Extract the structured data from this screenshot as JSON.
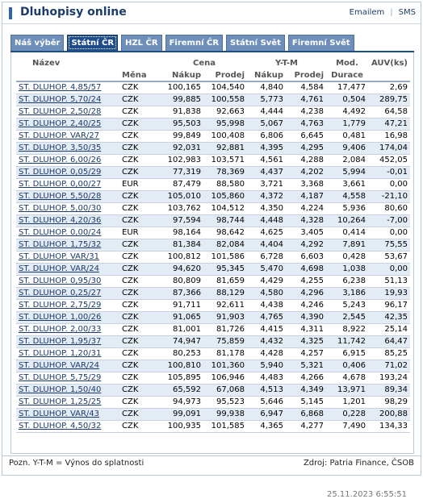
{
  "header": {
    "title": "Dluhopisy online",
    "links": [
      "Emailem",
      "SMS"
    ]
  },
  "tabs": [
    {
      "label": "Náš výběr",
      "active": false
    },
    {
      "label": "Státní ČR",
      "active": true
    },
    {
      "label": "HZL ČR",
      "active": false
    },
    {
      "label": "Firemní ČR",
      "active": false
    },
    {
      "label": "Státní Svět",
      "active": false
    },
    {
      "label": "Firemní Svět",
      "active": false
    }
  ],
  "table": {
    "group_headers": {
      "name": "Název",
      "price": "Cena",
      "ytm": "Y-T-M",
      "duration_top": "Mod.",
      "auv": "AUV(ks)"
    },
    "sub_headers": {
      "currency": "Měna",
      "price_buy": "Nákup",
      "price_sell": "Prodej",
      "ytm_buy": "Nákup",
      "ytm_sell": "Prodej",
      "duration": "Durace"
    },
    "rows": [
      [
        "ST. DLUHOP. 4,85/57",
        "CZK",
        "100,165",
        "104,540",
        "4,840",
        "4,584",
        "17,477",
        "2,69"
      ],
      [
        "ST. DLUHOP. 5,70/24",
        "CZK",
        "99,885",
        "100,558",
        "5,773",
        "4,761",
        "0,504",
        "289,75"
      ],
      [
        "ST. DLUHOP. 2,50/28",
        "CZK",
        "91,838",
        "92,663",
        "4,444",
        "4,238",
        "4,492",
        "64,58"
      ],
      [
        "ST. DLUHOP. 2,40/25",
        "CZK",
        "95,503",
        "95,998",
        "5,067",
        "4,763",
        "1,779",
        "47,21"
      ],
      [
        "ST. DLUHOP. VAR/27",
        "CZK",
        "99,849",
        "100,408",
        "6,806",
        "6,645",
        "0,481",
        "16,98"
      ],
      [
        "ST. DLUHOP. 3,50/35",
        "CZK",
        "92,031",
        "92,881",
        "4,395",
        "4,295",
        "9,406",
        "174,04"
      ],
      [
        "ST. DLUHOP. 6,00/26",
        "CZK",
        "102,983",
        "103,571",
        "4,561",
        "4,288",
        "2,084",
        "452,05"
      ],
      [
        "ST. DLUHOP. 0,05/29",
        "CZK",
        "77,319",
        "78,369",
        "4,437",
        "4,202",
        "5,994",
        "-0,01"
      ],
      [
        "ST. DLUHOP. 0,00/27",
        "EUR",
        "87,479",
        "88,580",
        "3,721",
        "3,368",
        "3,661",
        "0,00"
      ],
      [
        "ST. DLUHOP. 5,50/28",
        "CZK",
        "105,010",
        "105,860",
        "4,372",
        "4,187",
        "4,558",
        "-21,10"
      ],
      [
        "ST. DLUHOP. 5,00/30",
        "CZK",
        "103,762",
        "104,512",
        "4,350",
        "4,224",
        "5,936",
        "80,60"
      ],
      [
        "ST. DLUHOP. 4,20/36",
        "CZK",
        "97,594",
        "98,744",
        "4,448",
        "4,328",
        "10,264",
        "-7,00"
      ],
      [
        "ST. DLUHOP. 0,00/24",
        "EUR",
        "98,164",
        "98,642",
        "4,625",
        "3,405",
        "0,414",
        "0,00"
      ],
      [
        "ST. DLUHOP. 1,75/32",
        "CZK",
        "81,384",
        "82,084",
        "4,404",
        "4,292",
        "7,891",
        "75,55"
      ],
      [
        "ST. DLUHOP. VAR/31",
        "CZK",
        "100,812",
        "101,586",
        "6,728",
        "6,603",
        "0,428",
        "53,67"
      ],
      [
        "ST. DLUHOP. VAR/24",
        "CZK",
        "94,620",
        "95,345",
        "5,470",
        "4,698",
        "1,038",
        "0,00"
      ],
      [
        "ST. DLUHOP. 0,95/30",
        "CZK",
        "80,809",
        "81,659",
        "4,429",
        "4,255",
        "6,238",
        "51,13"
      ],
      [
        "ST. DLUHOP. 0,25/27",
        "CZK",
        "87,366",
        "88,129",
        "4,580",
        "4,296",
        "3,186",
        "19,93"
      ],
      [
        "ST. DLUHOP. 2,75/29",
        "CZK",
        "91,711",
        "92,611",
        "4,438",
        "4,246",
        "5,243",
        "96,17"
      ],
      [
        "ST. DLUHOP. 1,00/26",
        "CZK",
        "91,065",
        "91,903",
        "4,765",
        "4,390",
        "2,545",
        "42,35"
      ],
      [
        "ST. DLUHOP. 2,00/33",
        "CZK",
        "81,001",
        "81,726",
        "4,415",
        "4,311",
        "8,922",
        "25,14"
      ],
      [
        "ST. DLUHOP. 1,95/37",
        "CZK",
        "74,947",
        "75,859",
        "4,432",
        "4,325",
        "11,742",
        "64,47"
      ],
      [
        "ST. DLUHOP. 1,20/31",
        "CZK",
        "80,253",
        "81,178",
        "4,428",
        "4,257",
        "6,915",
        "85,25"
      ],
      [
        "ST. DLUHOP. VAR/24",
        "CZK",
        "100,810",
        "101,360",
        "5,940",
        "5,321",
        "0,406",
        "71,02"
      ],
      [
        "ST. DLUHOP. 5,75/29",
        "CZK",
        "105,895",
        "106,946",
        "4,483",
        "4,266",
        "4,678",
        "193,24"
      ],
      [
        "ST. DLUHOP. 1,50/40",
        "CZK",
        "65,592",
        "67,068",
        "4,513",
        "4,349",
        "13,971",
        "89,34"
      ],
      [
        "ST. DLUHOP. 1,25/25",
        "CZK",
        "94,973",
        "95,523",
        "5,646",
        "5,145",
        "1,201",
        "98,29"
      ],
      [
        "ST. DLUHOP. VAR/43",
        "CZK",
        "99,091",
        "99,938",
        "6,947",
        "6,868",
        "0,228",
        "200,88"
      ],
      [
        "ST. DLUHOP. 4,50/32",
        "CZK",
        "100,935",
        "101,585",
        "4,365",
        "4,277",
        "7,490",
        "134,33"
      ]
    ]
  },
  "timestamp": "25.11.2023 6:55:51",
  "footer": {
    "note": "Pozn. Y-T-M = Výnos do splatnosti",
    "source": "Zdroj: Patria Finance, ČSOB"
  }
}
